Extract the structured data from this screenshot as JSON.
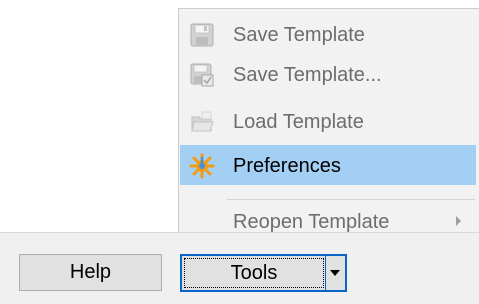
{
  "menu": {
    "items": [
      {
        "label": "Save Template",
        "icon": "floppy-disk-icon",
        "state": "disabled"
      },
      {
        "label": "Save Template...",
        "icon": "floppy-disk-save-as-icon",
        "state": "disabled"
      },
      {
        "label": "Load Template",
        "icon": "folder-open-icon",
        "state": "disabled"
      },
      {
        "label": "Preferences",
        "icon": "gear-icon",
        "state": "highlighted"
      },
      {
        "label": "Reopen Template",
        "icon": "",
        "state": "disabled",
        "has_submenu": true
      }
    ]
  },
  "buttons": {
    "help_label": "Help",
    "tools_label": "Tools"
  },
  "colors": {
    "menu_bg": "#f2f2f2",
    "highlight": "#a4cff5",
    "focus_border": "#0a64c8",
    "disabled_text": "#6d6d6d",
    "gear_orange": "#f39c12",
    "gear_blue": "#4a90d9"
  }
}
